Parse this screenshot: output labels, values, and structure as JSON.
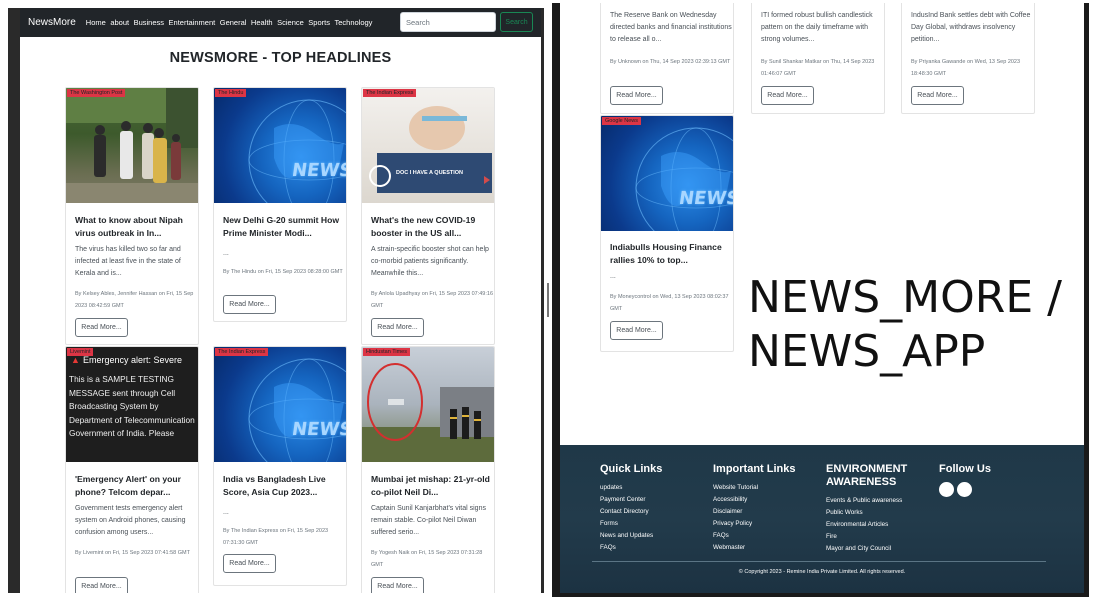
{
  "left": {
    "navbar": {
      "brand": "NewsMore",
      "links": [
        "Home",
        "about",
        "Business",
        "Entertainment",
        "General",
        "Health",
        "Science",
        "Sports",
        "Technology"
      ],
      "search_placeholder": "Search",
      "search_button": "Search"
    },
    "page_title": "NEWSMORE - TOP HEADLINES",
    "cards": [
      {
        "source": "The Washington Post",
        "title": "What to know about Nipah virus outbreak in In...",
        "desc": "The virus has killed two so far and infected at least five in the state of Kerala and is...",
        "meta": "By Kelsey Ables, Jennifer Hassan on Fri, 15 Sep 2023 08:42:59 GMT",
        "button": "Read More..."
      },
      {
        "source": "The Hindu",
        "title": "New Delhi G-20 summit How Prime Minister Modi...",
        "desc": "...",
        "meta": "By The Hindu on Fri, 15 Sep 2023 08:28:00 GMT",
        "button": "Read More..."
      },
      {
        "source": "The Indian Express",
        "title": "What's the new COVID-19 booster in the US all...",
        "desc": "A strain-specific booster shot can help co-morbid patients significantly. Meanwhile this...",
        "meta": "By Anlola Upadhyay on Fri, 15 Sep 2023 07:49:16 GMT",
        "button": "Read More...",
        "image_text": "DOC I HAVE A QUESTION"
      },
      {
        "source": "Livemint",
        "title": "'Emergency Alert' on your phone? Telcom depar...",
        "desc": "Government tests emergency alert system on Android phones, causing confusion among users...",
        "meta": "By Livemint on Fri, 15 Sep 2023 07:41:58 GMT",
        "button": "Read More...",
        "image_heading": "Emergency alert: Severe",
        "image_body": "This is a SAMPLE TESTING MESSAGE sent through Cell Broadcasting System by Department of Telecommunication Government of India. Please"
      },
      {
        "source": "The Indian Express",
        "title": "India vs Bangladesh Live Score, Asia Cup 2023...",
        "desc": "...",
        "meta": "By The Indian Express on Fri, 15 Sep 2023 07:31:30 GMT",
        "button": "Read More..."
      },
      {
        "source": "Hindustan Times",
        "title": "Mumbai jet mishap: 21-yr-old co-pilot Neil Di...",
        "desc": "Captain Sunil Kanjarbhat's vital signs remain stable. Co-pilot Neil Diwan suffered serio...",
        "meta": "By Yogesh Naik on Fri, 15 Sep 2023 07:31:28 GMT",
        "button": "Read More..."
      }
    ],
    "news_art_text": "NEWS"
  },
  "right": {
    "top_cards": [
      {
        "desc": "The Reserve Bank on Wednesday directed banks and financial institutions to release all o...",
        "meta": "By Unknown on Thu, 14 Sep 2023 02:39:13 GMT",
        "button": "Read More..."
      },
      {
        "desc": "ITI formed robust bullish candlestick pattern on the daily timeframe with strong volumes...",
        "meta": "By Sunil Shankar Matkar on Thu, 14 Sep 2023 01:46:07 GMT",
        "button": "Read More..."
      },
      {
        "desc": "IndusInd Bank settles debt with Coffee Day Global, withdraws insolvency petition...",
        "meta": "By Priyanka Gawande on Wed, 13 Sep 2023 18:48:30 GMT",
        "button": "Read More..."
      }
    ],
    "card": {
      "source": "Google News",
      "title": "Indiabulls Housing Finance rallies 10% to top...",
      "desc": "...",
      "meta": "By Moneycontrol on Wed, 13 Sep 2023 08:02:37 GMT",
      "button": "Read More..."
    },
    "big_label_line1": "NEWS_MORE /",
    "big_label_line2": "NEWS_APP",
    "footer": {
      "quick_links": {
        "heading": "Quick Links",
        "items": [
          "updates",
          "Payment Center",
          "Contact Directory",
          "Forms",
          "News and Updates",
          "FAQs"
        ]
      },
      "important_links": {
        "heading": "Important Links",
        "items": [
          "Website Tutorial",
          "Accessibility",
          "Disclaimer",
          "Privacy Policy",
          "FAQs",
          "Webmaster"
        ]
      },
      "environment": {
        "heading_line1": "ENVIRONMENT",
        "heading_line2": "AWARENESS",
        "items": [
          "Events & Public awareness",
          "Public Works",
          "Environmental Articles",
          "Fire",
          "Mayor and City Council"
        ]
      },
      "follow": {
        "heading": "Follow Us"
      },
      "copyright": "© Copyright 2023 - Remine India Private Limited. All rights reserved."
    }
  },
  "colors": {
    "navbar": "#212529",
    "badge": "#dc3545",
    "search_button": "#198754",
    "footer": "#223b4b"
  }
}
